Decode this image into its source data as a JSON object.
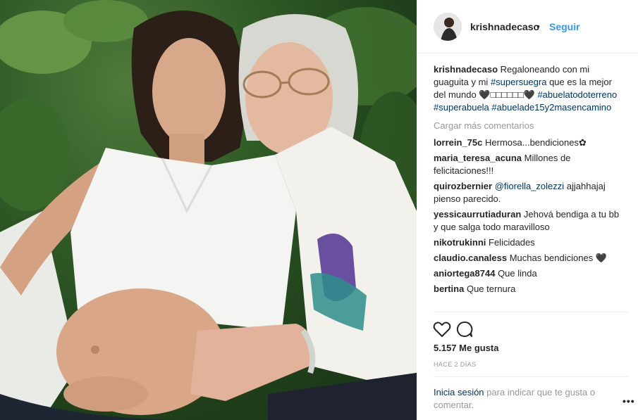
{
  "post": {
    "username": "krishnadecaso",
    "dot": "•",
    "follow_label": "Seguir",
    "caption": {
      "username": "krishnadecaso",
      "text_before": "Regaloneando con mi guaguita y mi",
      "hashtag1": "#supersuegra",
      "text_after": "que es la mejor del mundo 🖤□□□□□□🖤",
      "hashtag2": "#abuelatodoterreno",
      "hashtag3": "#superabuela",
      "hashtag4": "#abuelade15y2masencamino"
    },
    "load_more": "Cargar más comentarios",
    "comments": [
      {
        "user": "lorrein_75c",
        "text": "Hermosa...bendiciones✿"
      },
      {
        "user": "maria_teresa_acuna",
        "text": "Millones de felicitaciones!!!"
      },
      {
        "user": "quirozbernier",
        "mention": "@fiorella_zolezzi",
        "text": "ajjahhajaj pienso parecido."
      },
      {
        "user": "yessicaurrutiaduran",
        "text": "Jehová bendiga a tu bb y que salga todo maravilloso"
      },
      {
        "user": "nikotrukinni",
        "text": "Felicidades"
      },
      {
        "user": "claudio.canaless",
        "text": "Muchas bendiciones 🖤"
      },
      {
        "user": "aniortega8744",
        "text": "Que linda"
      },
      {
        "user": "bertina",
        "text": "Que ternura"
      }
    ],
    "likes": "5.157 Me gusta",
    "time": "HACE 2 DÍAS",
    "login_link": "Inicia sesión",
    "login_text": "para indicar que te gusta o comentar.",
    "more_label": "•••"
  },
  "icons": {
    "like": "heart-icon",
    "comment": "comment-icon",
    "more": "more-options-icon"
  },
  "colors": {
    "link_blue": "#3897f0",
    "hashtag": "#003569",
    "muted": "#999999",
    "text": "#262626"
  }
}
